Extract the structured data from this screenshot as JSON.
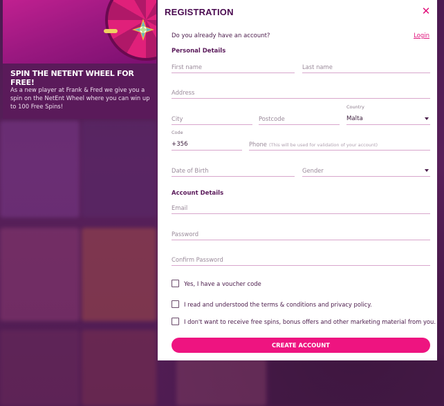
{
  "promo": {
    "title": "SPIN THE NETENT WHEEL FOR FREE!",
    "text": "As a new player at Frank & Fred we give you a spin on the NetEnt Wheel where you can win up to 100 Free Spins!"
  },
  "modal": {
    "title": "REGISTRATION",
    "close_symbol": "✕",
    "have_account": "Do you already have an account?",
    "login_label": "Login",
    "personal_section": "Personal Details",
    "account_section": "Account Details",
    "fields": {
      "first_name": "First name",
      "last_name": "Last name",
      "address": "Address",
      "city": "City",
      "postcode": "Postcode",
      "country_label": "Country",
      "country_value": "Malta",
      "code_label": "Code",
      "code_value": "+356",
      "phone": "Phone",
      "phone_hint": "(This will be used for validation of your account)",
      "dob": "Date of Birth",
      "gender": "Gender",
      "email": "Email",
      "password": "Password",
      "confirm_password": "Confirm Password"
    },
    "checkboxes": {
      "voucher": "Yes, I have a voucher code",
      "terms": "I read and understood the terms & conditions and privacy policy.",
      "marketing": "I don't want to receive free spins, bonus offers and other marketing material from you."
    },
    "cta_label": "CREATE ACCOUNT"
  },
  "colors": {
    "accent": "#ee1480",
    "heading": "#5a1a5a",
    "underline": "#d8a6cc"
  }
}
